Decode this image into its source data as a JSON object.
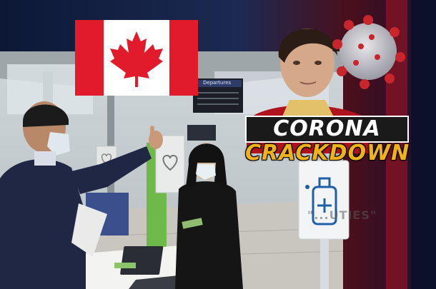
{
  "headline": {
    "line1": "CORONA",
    "line2": "CRACKDOWN"
  },
  "signs": {
    "departures": "Departures",
    "floor_text": "\"...UTIES\""
  },
  "colors": {
    "flag_red": "#e21b2c",
    "headline_gold": "#f0b21a",
    "virus_red": "#c8252c",
    "background_navy": "#0b1530"
  },
  "icons": [
    "maple-leaf-icon",
    "heart-icon",
    "sanitizer-icon",
    "coronavirus-icon"
  ]
}
